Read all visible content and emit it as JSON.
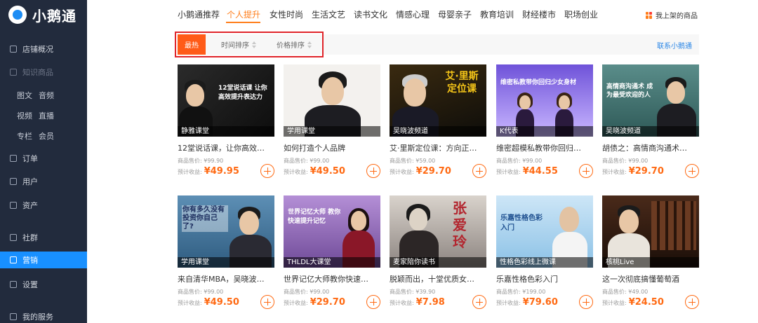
{
  "app": {
    "name": "小鹅通"
  },
  "sidebar": {
    "items": [
      {
        "label": "店铺概况",
        "icon": "shop-icon"
      },
      {
        "label": "知识商品",
        "icon": "grid-icon",
        "dim": true
      },
      {
        "label": "订单",
        "icon": "order-icon"
      },
      {
        "label": "用户",
        "icon": "user-icon"
      },
      {
        "label": "资产",
        "icon": "asset-icon"
      },
      {
        "label": "社群",
        "icon": "community-icon"
      },
      {
        "label": "营销",
        "icon": "marketing-icon",
        "active": true
      },
      {
        "label": "设置",
        "icon": "gear-icon"
      },
      {
        "label": "我的服务",
        "icon": "heart-icon"
      }
    ],
    "sub_items": [
      [
        "图文",
        "音频"
      ],
      [
        "视频",
        "直播"
      ],
      [
        "专栏",
        "会员"
      ]
    ]
  },
  "categories": [
    "小鹅通推荐",
    "个人提升",
    "女性时尚",
    "生活文艺",
    "读书文化",
    "情感心理",
    "母婴亲子",
    "教育培训",
    "财经楼市",
    "职场创业"
  ],
  "active_category": "个人提升",
  "shelf_link": "我上架的商品",
  "sort": {
    "hot": "最热",
    "time": "时间排序",
    "price": "价格排序",
    "contact": "联系小鹅通"
  },
  "price_prefix": "商品售价: ",
  "earn_prefix": "预计收益: ",
  "products": [
    {
      "title": "12堂说话课，让你高效提...",
      "label": "静雅课堂",
      "price": "¥99.90",
      "earn": "¥49.95",
      "banner": "12堂说话课 让你高效提升表达力"
    },
    {
      "title": "如何打造个人品牌",
      "label": "学用课堂",
      "price": "¥99.00",
      "earn": "¥49.50",
      "banner": ""
    },
    {
      "title": "艾·里斯定位课：方向正确...",
      "label": "吴晓波频道",
      "price": "¥59.00",
      "earn": "¥29.70",
      "banner": "艾·里斯 定位课"
    },
    {
      "title": "维密超模私教带你回归少...",
      "label": "K代表",
      "price": "¥99.00",
      "earn": "¥44.55",
      "banner": "维密私教带你回归少女身材"
    },
    {
      "title": "胡债之：高情商沟通术，...",
      "label": "吴晓波频道",
      "price": "¥99.00",
      "earn": "¥29.70",
      "banner": "高情商沟通术 成为最受欢迎的人"
    },
    {
      "title": "来自清华MBA，吴晓波推...",
      "label": "学用课堂",
      "price": "¥99.00",
      "earn": "¥49.50",
      "banner": "你有多久没有 投资你自己了?"
    },
    {
      "title": "世界记亿大师教你快速提...",
      "label": "THLDL大课堂",
      "price": "¥99.00",
      "earn": "¥29.70",
      "banner": "世界记忆大师 教你快速提升记忆"
    },
    {
      "title": "脱颖而出，十堂优质女性...",
      "label": "麦家陪你读书",
      "price": "¥39.90",
      "earn": "¥7.98",
      "banner": "张爱玲"
    },
    {
      "title": "乐嘉性格色彩入门",
      "label": "性格色彩线上微课",
      "price": "¥199.00",
      "earn": "¥79.60",
      "banner": "乐嘉性格色彩 入门"
    },
    {
      "title": "这一次彻底搞懂葡萄酒",
      "label": "核桃Live",
      "price": "¥49.00",
      "earn": "¥24.50",
      "banner": ""
    }
  ],
  "colors": {
    "accent": "#ff7e1b",
    "sidebar_bg": "#222b3d",
    "active_nav": "#1890ff",
    "highlight": "#e0252a",
    "link": "#2a86e6"
  }
}
